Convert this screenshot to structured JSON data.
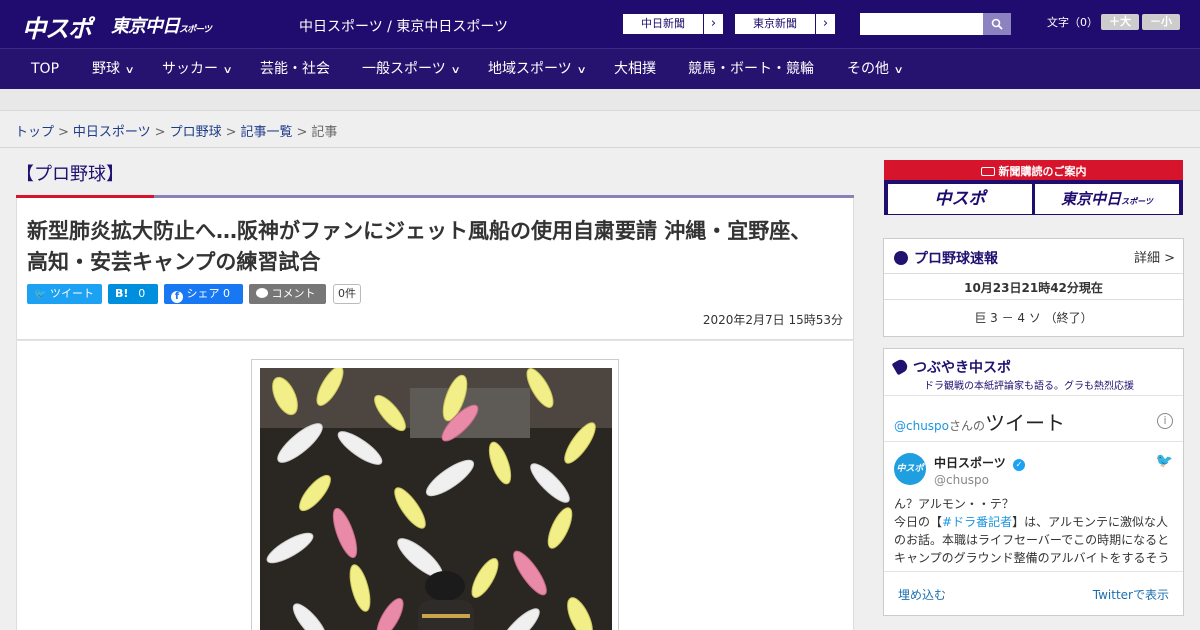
{
  "header": {
    "logo_chuspo": "中スポ",
    "logo_tokyo": "東京中日",
    "logo_tokyo_small": "スポーツ",
    "site_name": "中日スポーツ / 東京中日スポーツ",
    "ext_link_1": "中日新聞",
    "ext_link_2": "東京新聞",
    "font_size_label": "文字（0）",
    "font_plus": "＋大",
    "font_minus": "－小"
  },
  "nav": [
    {
      "label": "TOP",
      "dropdown": false
    },
    {
      "label": "野球",
      "dropdown": true
    },
    {
      "label": "サッカー",
      "dropdown": true
    },
    {
      "label": "芸能・社会",
      "dropdown": false
    },
    {
      "label": "一般スポーツ",
      "dropdown": true
    },
    {
      "label": "地域スポーツ",
      "dropdown": true
    },
    {
      "label": "大相撲",
      "dropdown": false
    },
    {
      "label": "競馬・ボート・競輪",
      "dropdown": false
    },
    {
      "label": "その他",
      "dropdown": true
    }
  ],
  "breadcrumb": {
    "items": [
      "トップ",
      "中日スポーツ",
      "プロ野球",
      "記事一覧"
    ],
    "current": "記事",
    "separator": ">"
  },
  "article": {
    "category": "【プロ野球】",
    "title": "新型肺炎拡大防止へ…阪神がファンにジェット風船の使用自粛要請 沖縄・宜野座、高知・安芸キャンプの練習試合",
    "share": {
      "tweet": "ツイート",
      "hatena_label": "B!",
      "hatena_count": "0",
      "facebook": "シェア 0",
      "comment": "コメント",
      "comment_count": "0件"
    },
    "date": "2020年2月7日 15時53分"
  },
  "sidebar": {
    "subscribe_header": "新聞購読のご案内",
    "subscribe_btn_1": "中スポ",
    "subscribe_btn_2": "東京中日",
    "subscribe_btn_2_small": "スポーツ",
    "score": {
      "title": "プロ野球速報",
      "detail": "詳細 >",
      "timestamp": "10月23日21時42分現在",
      "result": "巨 3 － 4 ソ （終了）"
    },
    "tsubuyaki": {
      "title": "つぶやき中スポ",
      "subtitle": "ドラ観戦の本紙評論家も語る。グラも熱烈応援",
      "handle_prefix": "@chuspo",
      "handle_suffix": "さんの",
      "tweets_label": "ツイート",
      "account_name": "中日スポーツ",
      "account_handle": "@chuspo",
      "avatar_text": "中スポ",
      "tweet_line1": "ん？アルモン・・テ？",
      "tweet_line2_a": "今日の【",
      "tweet_hashtag": "#ドラ番記者",
      "tweet_line2_b": "】は、アルモンテに激似な人",
      "tweet_line3": "のお話。本職はライフセーバーでこの時期になると",
      "tweet_line4": "キャンプのグラウンド整備のアルバイトをするそう",
      "embed": "埋め込む",
      "view_on_twitter": "Twitterで表示"
    }
  },
  "colors": {
    "brand_navy": "#1f0c6e",
    "nav_bg": "#26136f",
    "accent_red": "#d6142c",
    "twitter_blue": "#1da1f2",
    "hatena_blue": "#008fde",
    "facebook_blue": "#1877f2"
  }
}
